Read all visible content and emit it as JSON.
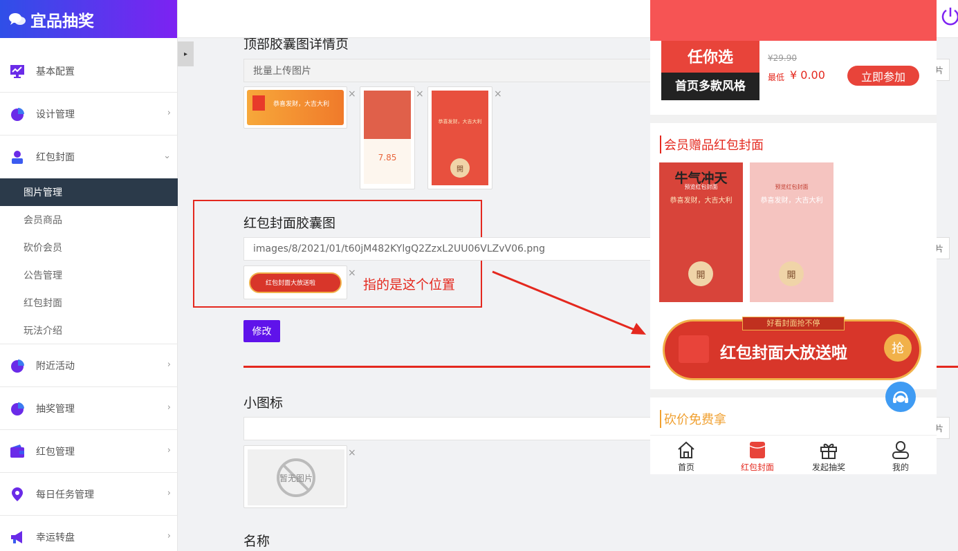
{
  "brand": {
    "title": "宜品抽奖"
  },
  "sidebar": {
    "items": [
      {
        "label": "基本配置",
        "icon": "monitor-icon"
      },
      {
        "label": "设计管理",
        "icon": "pie-chart-icon"
      },
      {
        "label": "红包封面",
        "icon": "user-icon"
      },
      {
        "label": "附近活动",
        "icon": "pie-chart-icon"
      },
      {
        "label": "抽奖管理",
        "icon": "pie-chart-icon"
      },
      {
        "label": "红包管理",
        "icon": "wallet-icon"
      },
      {
        "label": "每日任务管理",
        "icon": "location-icon"
      },
      {
        "label": "幸运转盘",
        "icon": "megaphone-icon"
      }
    ],
    "submenu": [
      "图片管理",
      "会员商品",
      "砍价会员",
      "公告管理",
      "红包封面",
      "玩法介绍"
    ],
    "chevron": "›",
    "chevron_down": "⌄"
  },
  "collapse_icon": "▸",
  "form": {
    "section1_label": "顶部胶囊图详情页",
    "section1_input": "批量上传图片",
    "thumb1_text": "恭喜发财，大吉大利",
    "thumb2_number": "7.85",
    "thumb3_caption": "恭喜发财，大吉大利",
    "thumb_open": "開",
    "capsule_label": "红包封面胶囊图",
    "capsule_path": "images/8/2021/01/t60jM482KYlgQ2ZzxL2UU06VLZvV06.png",
    "capsule_thumb_text": "红包封面大放送啦",
    "note": "指的是这个位置",
    "modify_button": "修改",
    "icon_label": "小图标",
    "icon_input": "",
    "no_image": "暂无图片",
    "name_label": "名称",
    "delete_mark": "×",
    "side_button": "片"
  },
  "phone": {
    "promo_big": "任你选",
    "promo_sub": "首页多款风格",
    "old_price": "¥29.90",
    "min_label": "最低",
    "price": "¥ 0.00",
    "join_button": "立即参加",
    "member_title": "会员赠品红包封面",
    "cover1_title": "牛气冲天",
    "cover1_tag": "预览红包封面",
    "cover_caption": "恭喜发财，大吉大利",
    "cover2_tag": "预览红包封面",
    "open_label": "開",
    "capsule_banner_top": "好看封面抢不停",
    "capsule_banner_text": "红包封面大放送啦",
    "capsule_grab": "抢",
    "bargain_title": "砍价免费拿",
    "tabs": [
      "首页",
      "红包封面",
      "发起抽奖",
      "我的"
    ]
  },
  "colors": {
    "brand_start": "#2f4fe8",
    "brand_end": "#7d22f2",
    "accent_red": "#e4281e",
    "button_purple": "#5f13ea",
    "phone_red": "#f65454"
  }
}
